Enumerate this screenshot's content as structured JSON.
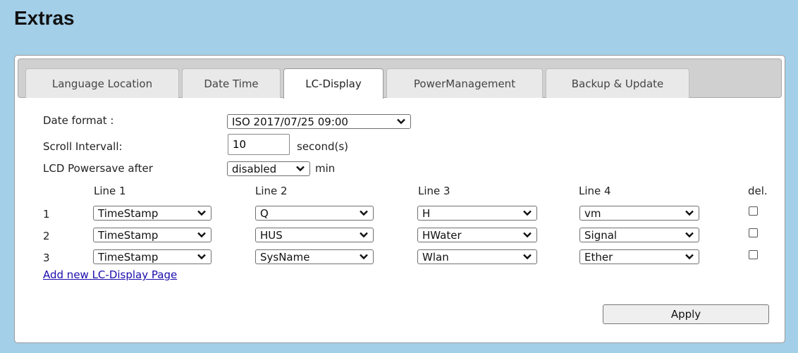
{
  "page": {
    "title": "Extras"
  },
  "tabs": [
    {
      "label": "Language Location"
    },
    {
      "label": "Date Time"
    },
    {
      "label": "LC-Display",
      "active": true
    },
    {
      "label": "PowerManagement"
    },
    {
      "label": "Backup & Update"
    }
  ],
  "form": {
    "date_format_label": "Date format :",
    "date_format_value": "ISO 2017/07/25 09:00",
    "scroll_interval_label": "Scroll Intervall:",
    "scroll_interval_value": "10",
    "scroll_interval_unit": "second(s)",
    "powersave_label": "LCD Powersave after",
    "powersave_value": "disabled",
    "powersave_unit": "min"
  },
  "lines_table": {
    "headers": [
      "Line 1",
      "Line 2",
      "Line 3",
      "Line 4",
      "del."
    ],
    "rows": [
      {
        "num": "1",
        "cells": [
          "TimeStamp",
          "Q",
          "H",
          "vm"
        ],
        "del": false
      },
      {
        "num": "2",
        "cells": [
          "TimeStamp",
          "HUS",
          "HWater",
          "Signal"
        ],
        "del": false
      },
      {
        "num": "3",
        "cells": [
          "TimeStamp",
          "SysName",
          "Wlan",
          "Ether"
        ],
        "del": false
      }
    ]
  },
  "add_page_link": "Add new LC-Display Page",
  "apply_label": "Apply",
  "colors": {
    "header_bg": "#a4cfe9",
    "link": "#1a0dab"
  }
}
